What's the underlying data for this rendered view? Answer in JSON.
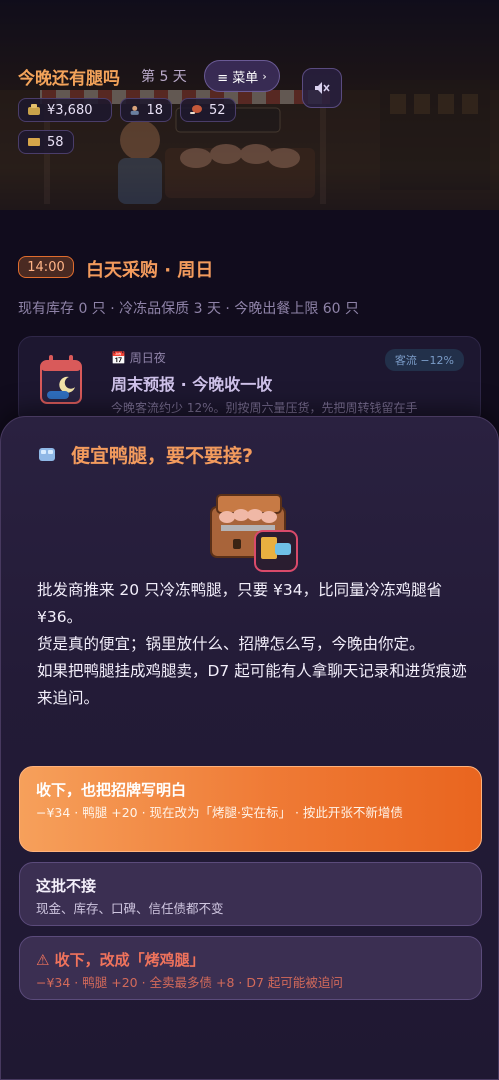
{
  "header": {
    "title": "今晚还有腿吗",
    "day": "第 5 天",
    "menu_label": "≡ 菜单",
    "stats": {
      "cash": "¥3,680",
      "customers": "18",
      "legs": "52",
      "tickets": "58"
    },
    "sign_text": "烤腿·实在标"
  },
  "status": {
    "time": "14:00",
    "phase": "白天采购 · 周日",
    "inventory": "现有库存 0 只 · 冷冻品保质 3 天 · 今晚出餐上限 60 只"
  },
  "event_card": {
    "date": "📅 周日夜",
    "title": "周末预报 · 今晚收一收",
    "body": "今晚客流约少 12%。别按周六量压货，先把周转钱留在手",
    "tag": "客流 −12%"
  },
  "modal": {
    "title": "便宜鸭腿，要不要接?",
    "paragraphs": [
      "批发商推来 20 只冷冻鸭腿，只要 ¥34，比同量冷冻鸡腿省 ¥36。",
      "货是真的便宜；锅里放什么、招牌怎么写，今晚由你定。",
      "如果把鸭腿挂成鸡腿卖，D7 起可能有人拿聊天记录和进货痕迹来追问。"
    ],
    "choices": [
      {
        "label": "收下，也把招牌写明白",
        "desc": "−¥34 · 鸭腿 +20 · 现在改为「烤腿·实在标」 · 按此开张不新增债"
      },
      {
        "label": "这批不接",
        "desc": "现金、库存、口碑、信任债都不变"
      },
      {
        "label": "⚠ 收下，改成「烤鸡腿」",
        "desc": "−¥34 · 鸭腿 +20 · 全卖最多债 +8 · D7 起可能被追问"
      }
    ]
  },
  "colors": {
    "accent": "#f39b5d",
    "primary_button": "#ef7a35",
    "danger": "#f0735c",
    "background": "#110c1d"
  },
  "icons": {
    "cash": "money-bag-icon",
    "customers": "person-icon",
    "legs": "drumstick-icon",
    "tickets": "ticket-icon",
    "calendar": "calendar-moon-icon",
    "modal": "ice-cube-icon"
  }
}
